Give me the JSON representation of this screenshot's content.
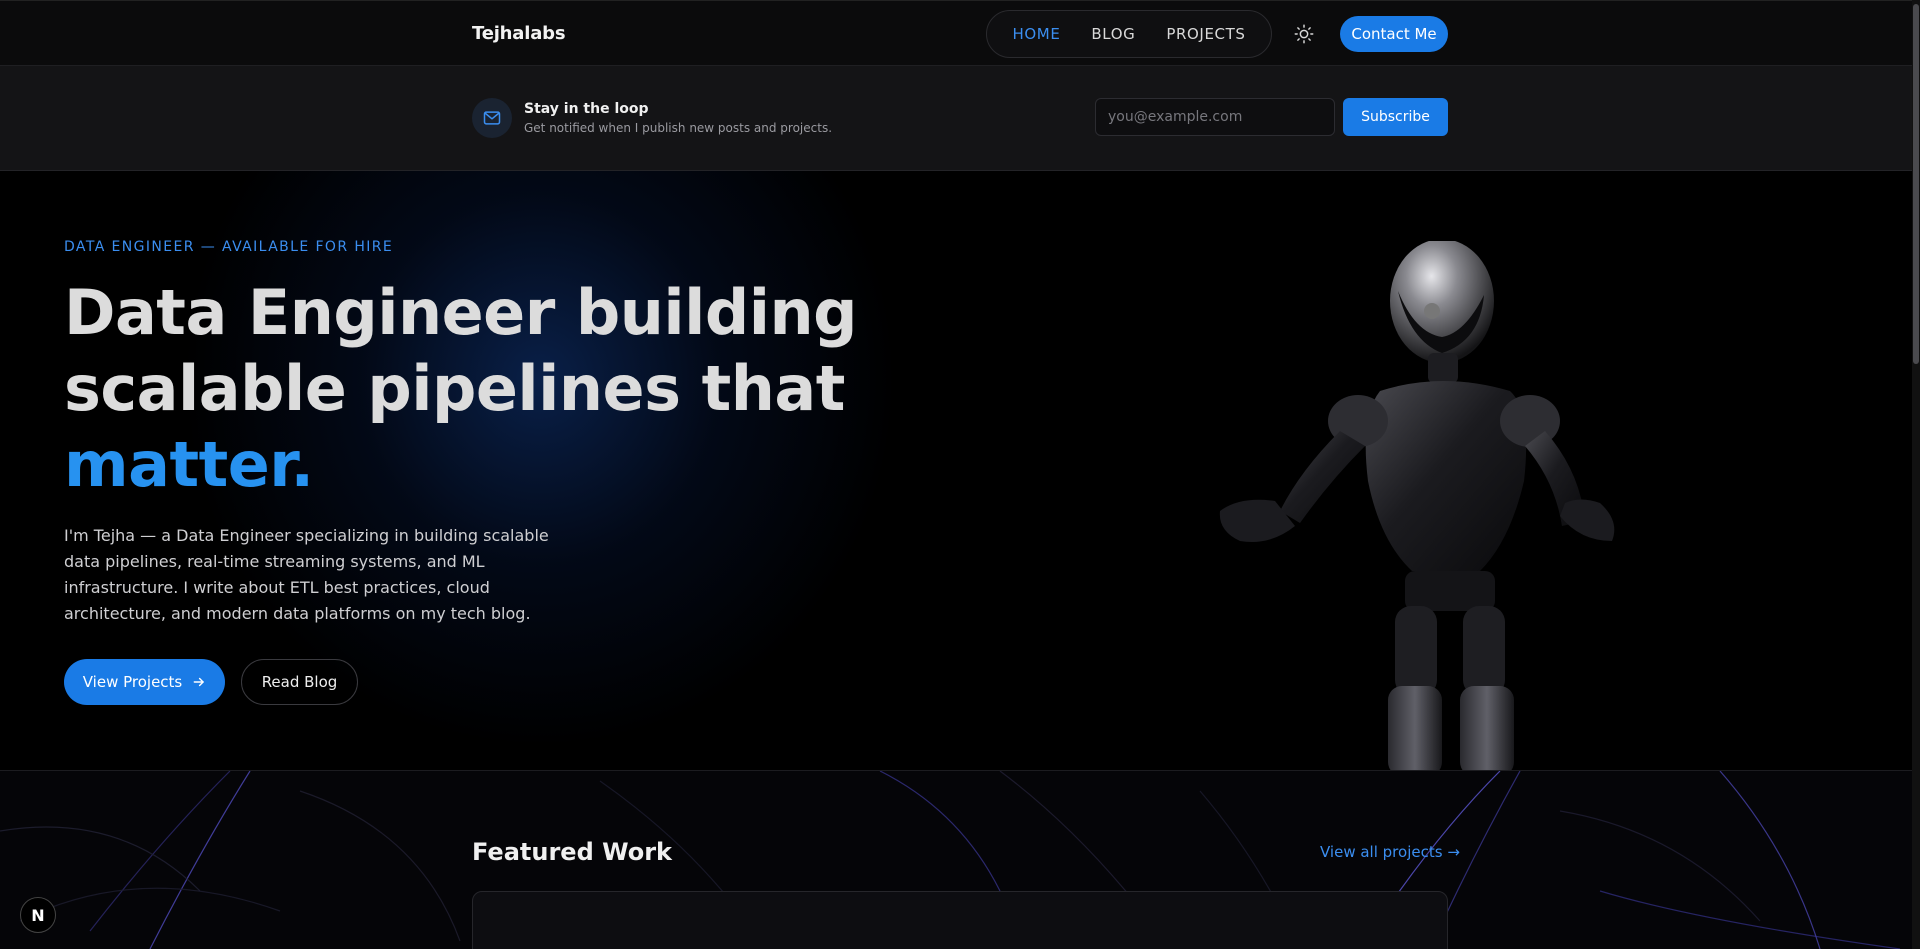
{
  "nav": {
    "brand": "Tejhalabs",
    "links": [
      {
        "label": "HOME",
        "active": true
      },
      {
        "label": "BLOG",
        "active": false
      },
      {
        "label": "PROJECTS",
        "active": false
      }
    ],
    "theme_icon": "sun-icon",
    "contact_label": "Contact Me"
  },
  "subscribe": {
    "icon": "mail-icon",
    "title": "Stay in the loop",
    "description": "Get notified when I publish new posts and projects.",
    "email_placeholder": "you@example.com",
    "email_value": "",
    "button_label": "Subscribe"
  },
  "hero": {
    "eyebrow": "DATA ENGINEER — AVAILABLE FOR HIRE",
    "headline_line1": "Data Engineer building",
    "headline_line2": "scalable pipelines that",
    "headline_accent": "matter.",
    "description": "I'm Tejha — a Data Engineer specializing in building scalable data pipelines, real-time streaming systems, and ML infrastructure. I write about ETL best practices, cloud architecture, and modern data platforms on my tech blog.",
    "primary_button": "View Projects",
    "secondary_button": "Read Blog"
  },
  "featured": {
    "title": "Featured Work",
    "view_all": "View all projects"
  },
  "badge": {
    "label": "N"
  },
  "colors": {
    "accent": "#1a7be6",
    "accent_text": "#3b8ef0",
    "background": "#000000",
    "nav_background": "#0b0b0c",
    "subbar_background": "#141416"
  }
}
